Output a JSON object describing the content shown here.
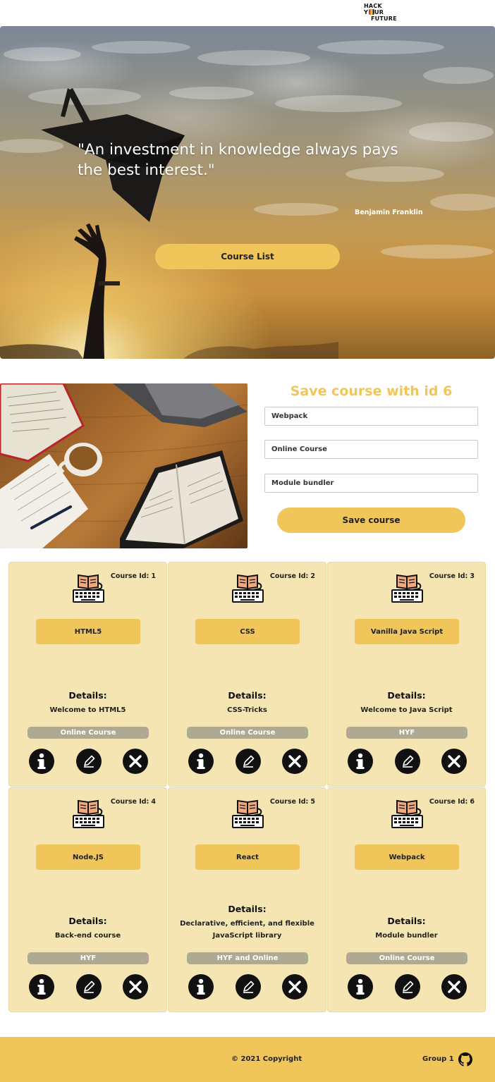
{
  "header": {
    "logo": {
      "line1": "HACK",
      "line2a": "Y",
      "line2b": "UR",
      "line3": "FUTURE"
    }
  },
  "hero": {
    "quote": "\"An investment in knowledge always pays the best interest.\"",
    "author": "Benjamin Franklin",
    "course_list_label": "Course List"
  },
  "form": {
    "title": "Save course with id 6",
    "name_value": "Webpack",
    "type_value": "Online Course",
    "description_value": "Module bundler",
    "save_label": "Save course"
  },
  "course_id_label": "Course Id:",
  "details_label": "Details:",
  "courses": [
    {
      "id": "1",
      "name": "HTML5",
      "description": "Welcome to HTML5",
      "type": "Online Course"
    },
    {
      "id": "2",
      "name": "CSS",
      "description": "CSS-Tricks",
      "type": "Online Course"
    },
    {
      "id": "3",
      "name": "Vanilla Java Script",
      "description": "Welcome to Java Script",
      "type": "HYF"
    },
    {
      "id": "4",
      "name": "Node.JS",
      "description": "Back-end course",
      "type": "HYF"
    },
    {
      "id": "5",
      "name": "React",
      "description": "Declarative, efficient, and flexible JavaScript library",
      "type": "HYF and Online"
    },
    {
      "id": "6",
      "name": "Webpack",
      "description": "Module bundler",
      "type": "Online Course"
    }
  ],
  "icons": {
    "course": "book-keyboard-icon",
    "info": "info-icon",
    "edit": "pencil-icon",
    "delete": "close-icon",
    "github": "github-icon"
  },
  "colors": {
    "accent": "#f0c55a",
    "card_bg": "#f4e5b3",
    "badge_bg": "#afa993",
    "action_bg": "#111111"
  },
  "footer": {
    "copyright": "© 2021 Copyright",
    "group": "Group 1"
  }
}
